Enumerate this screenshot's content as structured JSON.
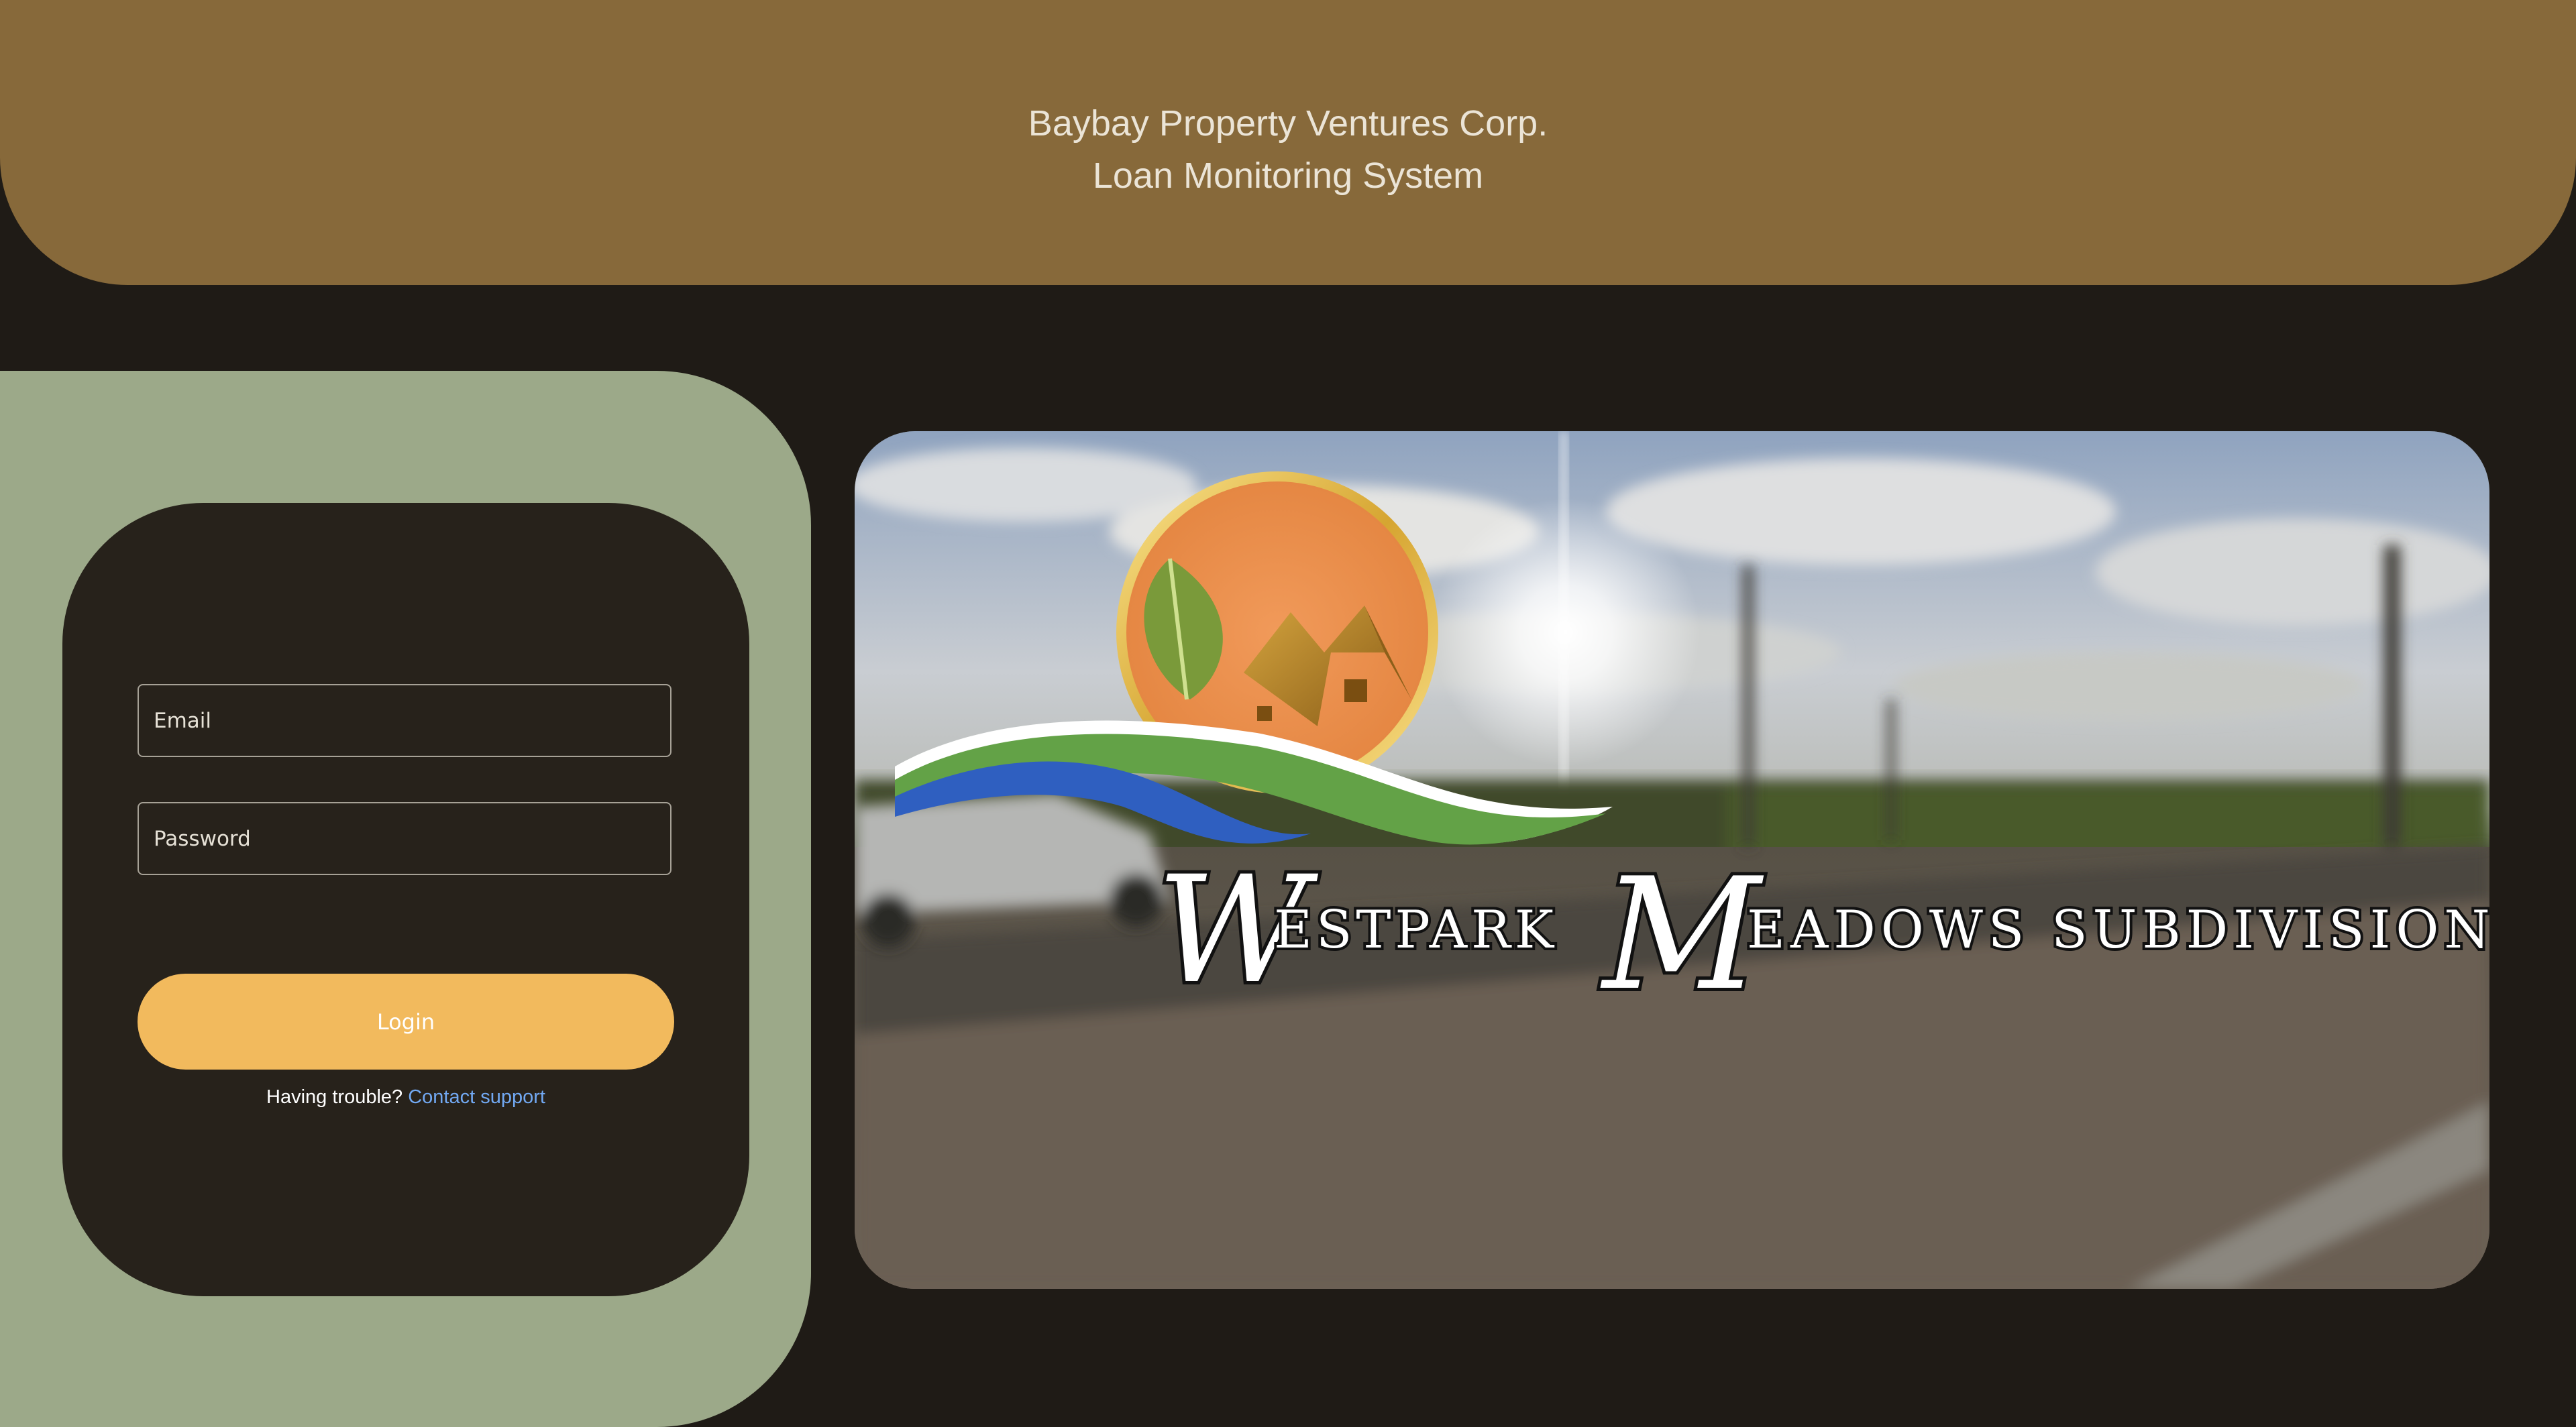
{
  "header": {
    "company": "Baybay Property Ventures Corp.",
    "system": "Loan Monitoring System"
  },
  "login": {
    "email_placeholder": "Email",
    "password_placeholder": "Password",
    "login_label": "Login",
    "help_text": "Having trouble?",
    "support_link": "Contact support"
  },
  "hero": {
    "logo_initial_1": "W",
    "logo_word_1": "ESTPARK",
    "logo_initial_2": "M",
    "logo_word_2": "EADOWS SUBDIVISION"
  },
  "colors": {
    "header": "#87693a",
    "background": "#1f1b16",
    "panel": "#9ca989",
    "card": "#27221b",
    "button": "#f2ba5d",
    "link": "#72a9f3"
  }
}
